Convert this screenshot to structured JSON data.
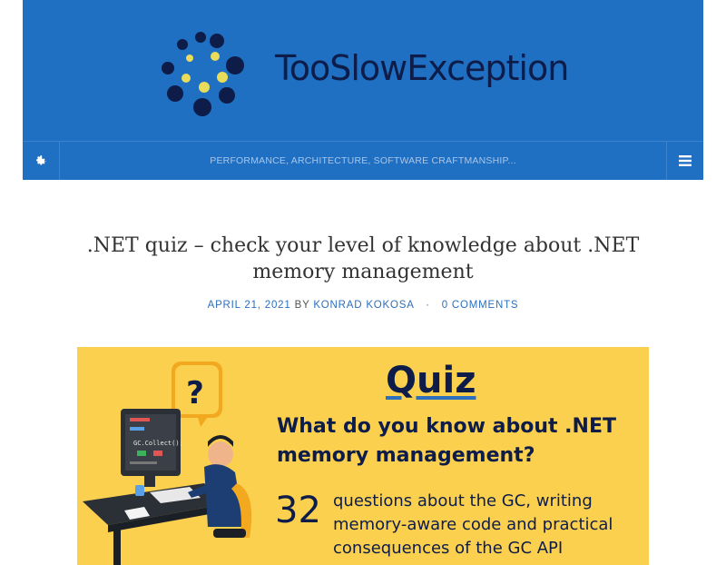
{
  "site": {
    "title": "TooSlowException",
    "tagline": "PERFORMANCE, ARCHITECTURE, SOFTWARE CRAFTMANSHIP...",
    "colors": {
      "header": "#1f6fc2",
      "title": "#0d1c48",
      "link": "#2b6fbe"
    }
  },
  "nav": {
    "settings_icon": "gear-icon",
    "menu_icon": "hamburger-menu-icon"
  },
  "post": {
    "title": ".NET quiz – check your level of knowledge about .NET memory management",
    "date": "APRIL 21, 2021",
    "by": "BY",
    "author": "KONRAD KOKOSA",
    "separator": "·",
    "comments": "0 COMMENTS"
  },
  "featured_image": {
    "heading": "Quiz",
    "question": "What do you know about .NET memory management?",
    "number": "32",
    "description": "questions about the GC, writing memory-aware code and practical consequences of the GC API",
    "question_mark": "?",
    "screen_code": "GC.Collect();",
    "background": "#fbd04e"
  }
}
